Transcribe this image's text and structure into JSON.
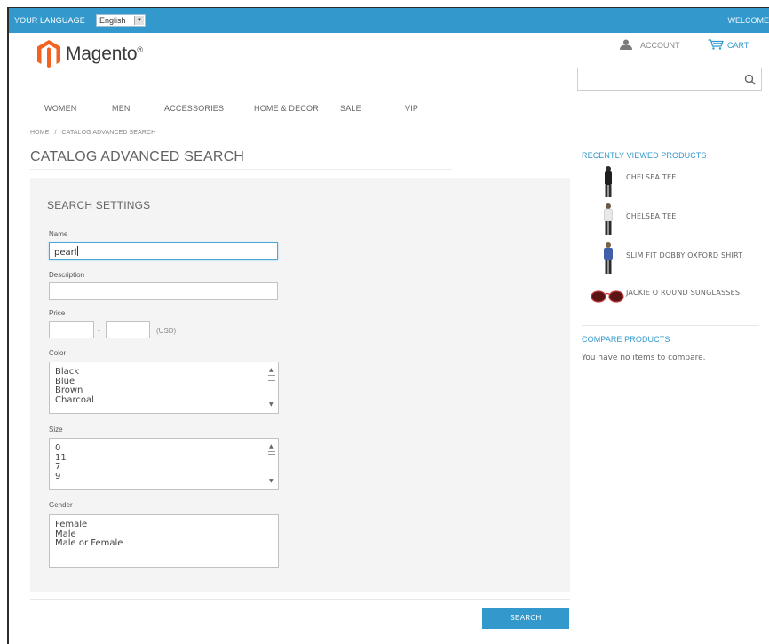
{
  "header": {
    "language_label": "YOUR LANGUAGE",
    "language_value": "English",
    "welcome": "WELCOME",
    "logo_text": "Magento",
    "logo_mark": "®",
    "account_label": "ACCOUNT",
    "cart_label": "CART",
    "search_placeholder": ""
  },
  "nav": {
    "items": [
      "WOMEN",
      "MEN",
      "ACCESSORIES",
      "HOME & DECOR",
      "SALE",
      "VIP"
    ]
  },
  "breadcrumb": {
    "home": "HOME",
    "separator": "/",
    "current": "CATALOG ADVANCED SEARCH"
  },
  "page": {
    "title": "CATALOG ADVANCED SEARCH"
  },
  "form": {
    "heading": "SEARCH SETTINGS",
    "name_label": "Name",
    "name_value": "pearl",
    "description_label": "Description",
    "description_value": "",
    "price_label": "Price",
    "price_from": "",
    "price_to": "",
    "price_dash": "-",
    "currency": "(USD)",
    "color_label": "Color",
    "color_options": [
      "Black",
      "Blue",
      "Brown",
      "Charcoal"
    ],
    "size_label": "Size",
    "size_options": [
      "0",
      "11",
      "7",
      "9"
    ],
    "gender_label": "Gender",
    "gender_options": [
      "Female",
      "Male",
      "Male or Female"
    ],
    "search_button": "SEARCH"
  },
  "sidebar": {
    "recent_heading": "RECENTLY VIEWED PRODUCTS",
    "recent_items": [
      {
        "name": "CHELSEA TEE"
      },
      {
        "name": "CHELSEA TEE"
      },
      {
        "name": "SLIM FIT DOBBY OXFORD SHIRT"
      },
      {
        "name": "JACKIE O ROUND SUNGLASSES"
      }
    ],
    "compare_heading": "COMPARE PRODUCTS",
    "compare_text": "You have no items to compare."
  },
  "colors": {
    "brand_blue": "#3399cc",
    "logo_orange": "#f26322",
    "panel_bg": "#f4f4f4"
  }
}
